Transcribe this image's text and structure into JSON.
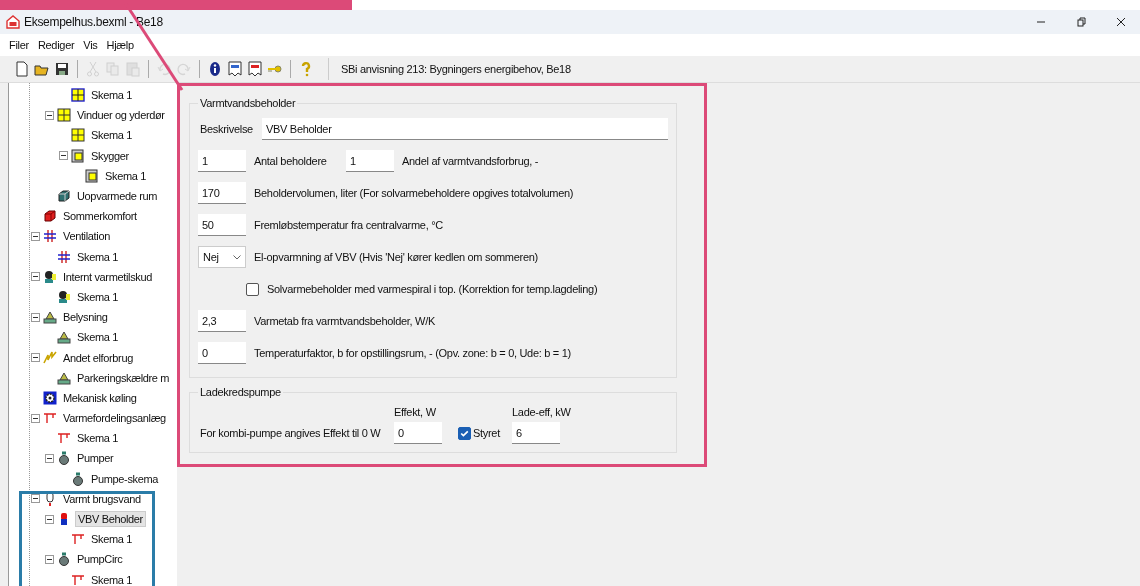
{
  "window": {
    "title": "Eksempelhus.bexml - Be18"
  },
  "menu": [
    "Filer",
    "Rediger",
    "Vis",
    "Hjælp"
  ],
  "toolbar": {
    "groups": [
      [
        {
          "kind": "new",
          "disabled": false
        },
        {
          "kind": "open",
          "disabled": false
        },
        {
          "kind": "save",
          "disabled": false
        }
      ],
      [
        {
          "kind": "cut",
          "disabled": true
        },
        {
          "kind": "copy",
          "disabled": true
        },
        {
          "kind": "paste",
          "disabled": true
        }
      ],
      [
        {
          "kind": "undo",
          "disabled": true
        },
        {
          "kind": "redo",
          "disabled": true
        }
      ],
      [
        {
          "kind": "info",
          "disabled": false
        },
        {
          "kind": "report",
          "disabled": false
        },
        {
          "kind": "report-red",
          "disabled": false
        },
        {
          "kind": "key",
          "disabled": false
        }
      ],
      [
        {
          "kind": "help",
          "disabled": false
        }
      ]
    ],
    "caption": "SBi anvisning 213: Bygningers energibehov, Be18"
  },
  "tree": {
    "items": [
      {
        "children": [
          {
            "children": [
              {
                "label": "Skema 1",
                "kind": "construction",
                "selected": false
              }
            ]
          },
          {
            "label": "Vinduer og yderdør",
            "kind": "window",
            "selected": false,
            "expanded": true,
            "children": [
              {
                "label": "Skema 1",
                "kind": "window",
                "selected": false
              },
              {
                "label": "Skygger",
                "kind": "shade",
                "selected": false,
                "expanded": true,
                "children": [
                  {
                    "label": "Skema 1",
                    "kind": "shade",
                    "selected": false
                  }
                ]
              }
            ]
          },
          {
            "label": "Uopvarmede rum",
            "kind": "unheated",
            "selected": false
          }
        ]
      },
      {
        "label": "Sommerkomfort",
        "kind": "summer",
        "selected": false
      },
      {
        "label": "Ventilation",
        "kind": "ventilation",
        "selected": false,
        "expanded": true,
        "children": [
          {
            "label": "Skema 1",
            "kind": "ventilation",
            "selected": false
          }
        ]
      },
      {
        "label": "Internt varmetilskud",
        "kind": "internal-gain",
        "selected": false,
        "expanded": true,
        "children": [
          {
            "label": "Skema 1",
            "kind": "internal-gain",
            "selected": false
          }
        ]
      },
      {
        "label": "Belysning",
        "kind": "lighting",
        "selected": false,
        "expanded": true,
        "children": [
          {
            "label": "Skema 1",
            "kind": "lighting",
            "selected": false
          }
        ]
      },
      {
        "label": "Andet elforbrug",
        "kind": "electric",
        "selected": false,
        "expanded": true,
        "children": [
          {
            "label": "Parkeringskældre m",
            "kind": "lighting",
            "selected": false
          }
        ]
      },
      {
        "label": "Mekanisk køling",
        "kind": "cooling",
        "selected": false
      },
      {
        "label": "Varmefordelingsanlæg",
        "kind": "distribution",
        "selected": false,
        "expanded": true,
        "children": [
          {
            "label": "Skema 1",
            "kind": "distribution",
            "selected": false
          },
          {
            "label": "Pumper",
            "kind": "pump",
            "selected": false,
            "expanded": true,
            "children": [
              {
                "label": "Pumpe-skema",
                "kind": "pump",
                "selected": false
              }
            ]
          }
        ]
      },
      {
        "label": "Varmt brugsvand",
        "kind": "hot-water",
        "selected": false,
        "expanded": true,
        "children": [
          {
            "label": "VBV Beholder",
            "kind": "tank",
            "selected": true,
            "expanded": true,
            "children": [
              {
                "label": "Skema 1",
                "kind": "distribution",
                "selected": false
              }
            ]
          },
          {
            "label": "PumpCirc",
            "kind": "pump",
            "selected": false,
            "expanded": true,
            "children": [
              {
                "label": "Skema 1",
                "kind": "distribution",
                "selected": false
              }
            ]
          }
        ]
      }
    ]
  },
  "tank": {
    "title": "Varmtvandsbeholder",
    "description": {
      "label": "Beskrivelse",
      "value": "VBV Beholder"
    },
    "rows": [
      {
        "kind": "pair",
        "value": "1",
        "label": "Antal beholdere",
        "value_2": "1",
        "label_2": "Andel af varmtvandsforbrug, -"
      },
      {
        "kind": "input",
        "value": "170",
        "label": "Beholdervolumen, liter (For solvarmebeholdere opgives totalvolumen)"
      },
      {
        "kind": "input",
        "value": "50",
        "label": "Fremløbstemperatur fra centralvarme, °C"
      },
      {
        "kind": "select",
        "value": "Nej",
        "label": "El-opvarmning af VBV (Hvis 'Nej' kører kedlen om sommeren)"
      },
      {
        "kind": "checkbox",
        "checked": false,
        "label": "Solvarmebeholder med varmespiral i top. (Korrektion for temp.lagdeling)"
      },
      {
        "kind": "input",
        "value": "2,3",
        "label": "Varmetab fra varmtvandsbeholder, W/K"
      },
      {
        "kind": "input",
        "value": "0",
        "label": "Temperaturfaktor, b for opstillingsrum, - (Opv. zone: b = 0, Ude: b = 1)"
      }
    ]
  },
  "pump": {
    "title": "Ladekredspumpe",
    "note": "For kombi-pumpe angives Effekt til 0 W",
    "effect_label": "Effekt, W",
    "effect_value": "0",
    "controlled": {
      "label": "Styret",
      "checked": true
    },
    "charge_label": "Lade-eff, kW",
    "charge_value": "6"
  }
}
